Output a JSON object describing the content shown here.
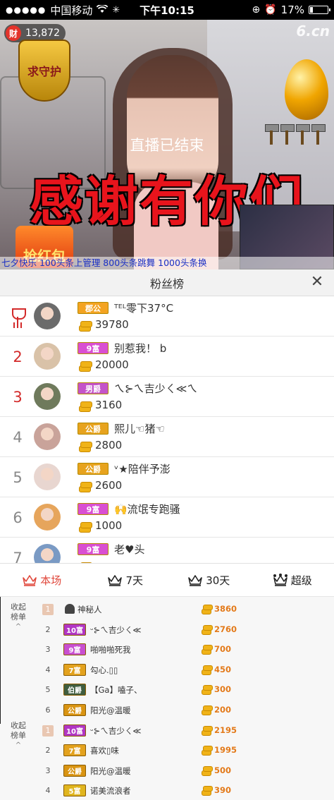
{
  "status_bar": {
    "carrier": "中国移动",
    "time": "下午10:15",
    "battery": "17%",
    "battery_level": 0.17
  },
  "video": {
    "cai_badge": "财",
    "viewer_count": "13,872",
    "site_logo": "6.cn",
    "guard_label": "求守护",
    "ended_text": "直播已结束",
    "overlay_text": "感谢有你们",
    "redpack_label": "抢红包",
    "ticker": "七夕快乐  100头条上管理  800头条跳舞  1000头条换"
  },
  "fans_panel": {
    "title": "粉丝榜",
    "close_icon": "close-icon"
  },
  "fans": [
    {
      "rank": "1",
      "rank_icon": "trophy-icon",
      "badge": "郡公",
      "badge_color": "#f3a321",
      "name": "ᵀᴱᴸ零下37°C",
      "amount": "39780"
    },
    {
      "rank": "2",
      "badge": "9富",
      "badge_color": "#d94fd2",
      "name": "别惹我！ b",
      "amount": "20000"
    },
    {
      "rank": "3",
      "badge": "男爵",
      "badge_color": "#c454c9",
      "name": "ㄟ⊱ㄟ吉少ㄑ≪ㄟ",
      "amount": "3160"
    },
    {
      "rank": "4",
      "badge": "公爵",
      "badge_color": "#e7a31e",
      "name": "熙儿☜猪☜",
      "amount": "2800"
    },
    {
      "rank": "5",
      "badge": "公爵",
      "badge_color": "#e7a31e",
      "name": "ᵛ★陪伴予澎",
      "amount": "2600"
    },
    {
      "rank": "6",
      "badge": "9富",
      "badge_color": "#d94fd2",
      "name": "🙌流氓专跑骚",
      "amount": "1000"
    },
    {
      "rank": "7",
      "badge": "9富",
      "badge_color": "#d94fd2",
      "name": "老♥头",
      "amount": ""
    }
  ],
  "tabs": [
    {
      "label": "本场",
      "icon": "crown-outline-icon",
      "active": true
    },
    {
      "label": "7天",
      "icon": "crown-outline-icon",
      "active": false
    },
    {
      "label": "30天",
      "icon": "crown-outline-icon",
      "active": false
    },
    {
      "label": "超级",
      "icon": "crown-dots-icon",
      "active": false
    }
  ],
  "bottom_sections": [
    {
      "label_line1": "收起",
      "label_line2": "榜单"
    },
    {
      "label_line1": "收起",
      "label_line2": "榜单"
    }
  ],
  "bottom_rows": [
    {
      "rank": "1",
      "badge": "",
      "badge_color": "",
      "name": "神秘人",
      "amount": "3860"
    },
    {
      "rank": "2",
      "badge": "10富",
      "badge_color": "#b136c4",
      "name": "ᵕ⊱ㄟ吉少ㄑ≪",
      "amount": "2760"
    },
    {
      "rank": "3",
      "badge": "9富",
      "badge_color": "#c84fd0",
      "name": "啪啪啪死我",
      "amount": "700"
    },
    {
      "rank": "4",
      "badge": "7富",
      "badge_color": "#e3a21e",
      "name": "勾心.▯▯",
      "amount": "450"
    },
    {
      "rank": "5",
      "badge": "伯爵",
      "badge_color": "#3f5d3f",
      "name": "【Ga】嗑子、",
      "amount": "300"
    },
    {
      "rank": "6",
      "badge": "公爵",
      "badge_color": "#d99412",
      "name": "阳光@温暖",
      "amount": "200"
    },
    {
      "rank": "1",
      "badge": "10富",
      "badge_color": "#b136c4",
      "name": "ᵕ⊱ㄟ吉少ㄑ≪",
      "amount": "2195"
    },
    {
      "rank": "2",
      "badge": "7富",
      "badge_color": "#e3a21e",
      "name": "喜欢▯味",
      "amount": "1995"
    },
    {
      "rank": "3",
      "badge": "公爵",
      "badge_color": "#d99412",
      "name": "阳光@温暖",
      "amount": "500"
    },
    {
      "rank": "4",
      "badge": "5富",
      "badge_color": "#e0b51e",
      "name": "诺美流浪者",
      "amount": "390"
    }
  ]
}
